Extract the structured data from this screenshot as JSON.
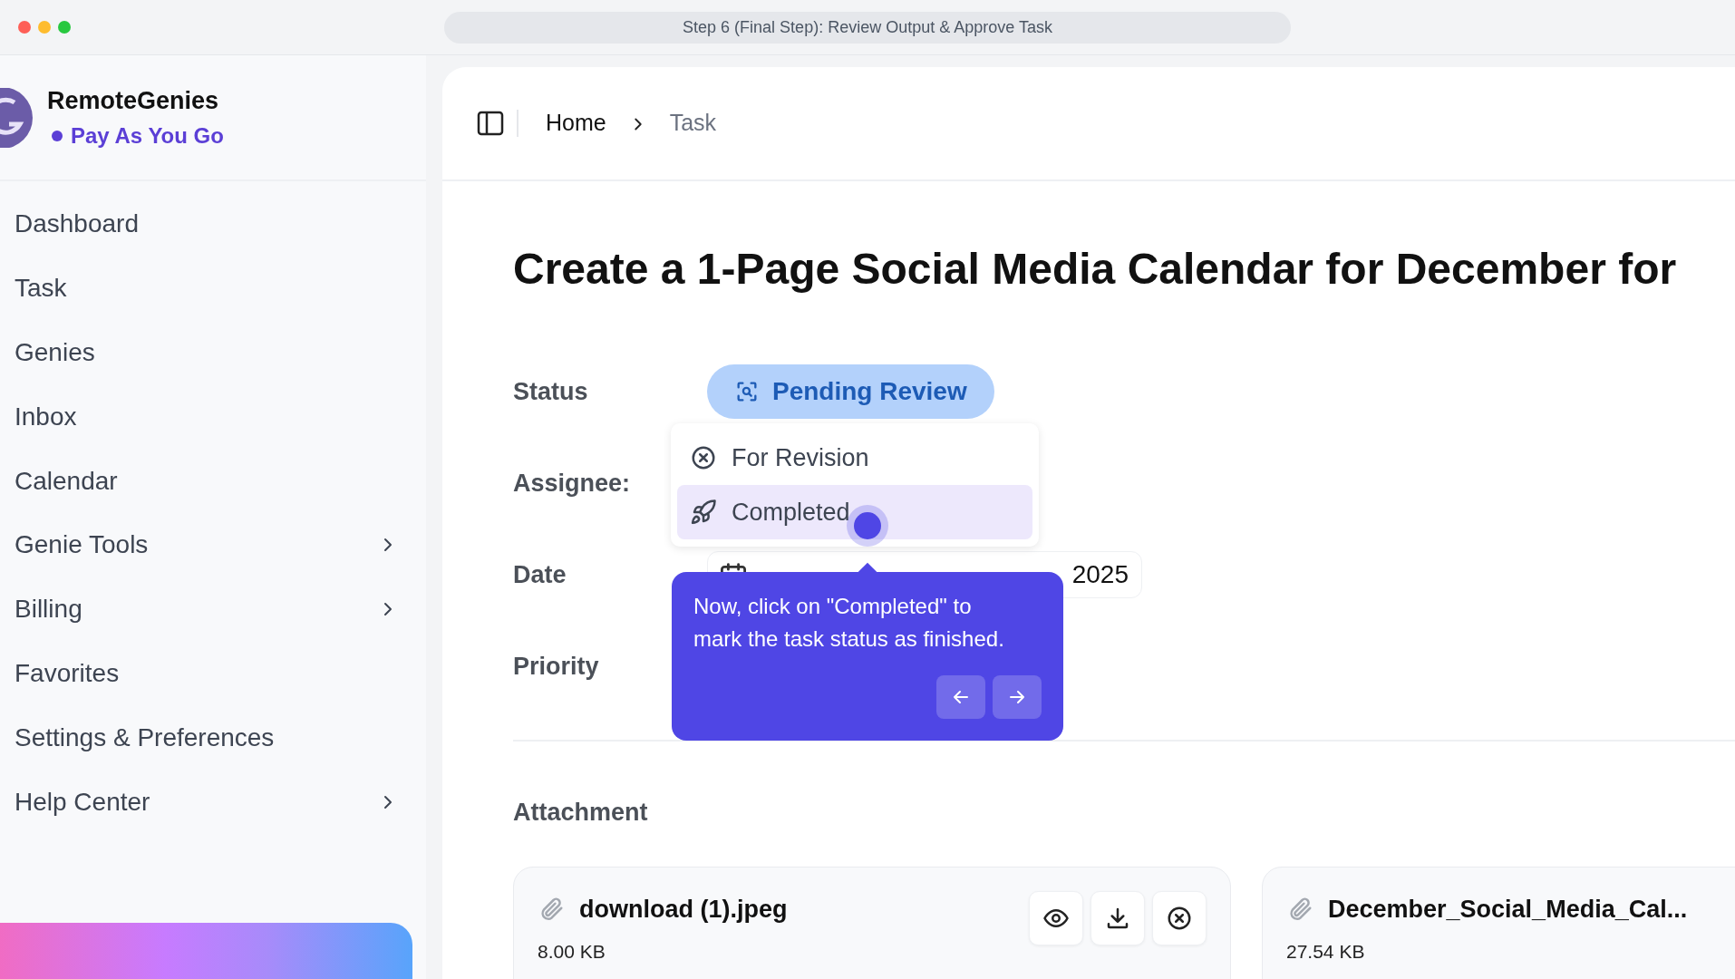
{
  "window": {
    "title": "Step 6 (Final Step): Review Output & Approve Task"
  },
  "sidebar": {
    "brand": "RemoteGenies",
    "plan": "Pay As You Go",
    "items": [
      {
        "label": "Dashboard",
        "expandable": false
      },
      {
        "label": "Task",
        "expandable": false
      },
      {
        "label": "Genies",
        "expandable": false
      },
      {
        "label": "Inbox",
        "expandable": false
      },
      {
        "label": "Calendar",
        "expandable": false
      },
      {
        "label": "Genie Tools",
        "expandable": true
      },
      {
        "label": "Billing",
        "expandable": true
      },
      {
        "label": "Favorites",
        "expandable": false
      },
      {
        "label": "Settings & Preferences",
        "expandable": false
      },
      {
        "label": "Help Center",
        "expandable": true
      }
    ]
  },
  "breadcrumb": [
    {
      "label": "Home",
      "current": false
    },
    {
      "label": "Task",
      "current": true
    }
  ],
  "task": {
    "title": "Create a 1-Page Social Media Calendar for December for",
    "fields": [
      {
        "kind": "status",
        "label": "Status",
        "value": "Pending Review"
      },
      {
        "kind": "assignee",
        "label": "Assignee:"
      },
      {
        "kind": "date",
        "label": "Date",
        "value": "2025"
      },
      {
        "kind": "priority",
        "label": "Priority"
      }
    ]
  },
  "status_menu": [
    {
      "kind": "revision",
      "label": "For Revision",
      "selected": false
    },
    {
      "kind": "completed",
      "label": "Completed",
      "selected": true
    }
  ],
  "tooltip": {
    "text": "Now, click on \"Completed\" to mark the task status as finished.",
    "buttons": [
      {
        "kind": "back"
      },
      {
        "kind": "next"
      }
    ]
  },
  "attachments": {
    "title": "Attachment",
    "files": [
      {
        "name": "download (1).jpeg",
        "size": "8.00 KB",
        "actions": [
          {
            "kind": "view"
          },
          {
            "kind": "download"
          },
          {
            "kind": "remove"
          }
        ]
      },
      {
        "name": "December_Social_Media_Cal...",
        "size": "27.54 KB"
      }
    ]
  }
}
